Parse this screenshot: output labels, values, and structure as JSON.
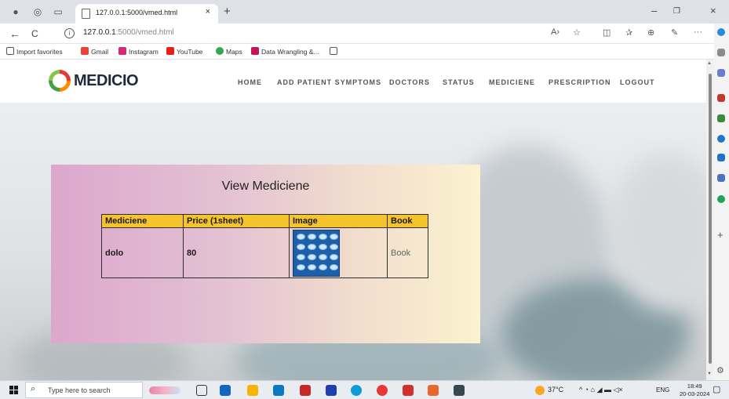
{
  "browser": {
    "tab_title": "127.0.0.1:5000/vmed.html",
    "tab_close": "×",
    "new_tab": "+",
    "url_host": "127.0.0.1",
    "url_rest": ":5000/vmed.html",
    "minimize": "–",
    "restore": "❐",
    "close": "×",
    "back": "←",
    "reload": "C",
    "more": "···"
  },
  "favorites": [
    {
      "label": "Import favorites",
      "color": "#ffffff"
    },
    {
      "label": "Gmail",
      "color": "#ea4335"
    },
    {
      "label": "Instagram",
      "color": "#d62976"
    },
    {
      "label": "YouTube",
      "color": "#e62117"
    },
    {
      "label": "Maps",
      "color": "#34a853"
    },
    {
      "label": "Data Wrangling &...",
      "color": "#c2185b"
    }
  ],
  "site": {
    "logo": "MEDICIO",
    "nav": [
      "HOME",
      "ADD PATIENT SYMPTOMS",
      "DOCTORS",
      "STATUS",
      "MEDICIENE",
      "PRESCRIPTION",
      "LOGOUT"
    ]
  },
  "card": {
    "title": "View Mediciene",
    "headers": [
      "Mediciene",
      "Price (1sheet)",
      "Image",
      "Book"
    ],
    "rows": [
      {
        "name": "dolo",
        "price": "80",
        "book": "Book"
      }
    ]
  },
  "taskbar": {
    "search_placeholder": "Type here to search",
    "temperature": "37°C",
    "language": "ENG",
    "time": "18:49",
    "date": "20-03-2024"
  }
}
